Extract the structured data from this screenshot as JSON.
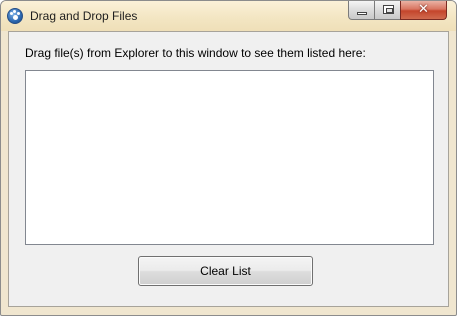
{
  "window": {
    "title": "Drag and Drop Files",
    "icon": "paw-icon"
  },
  "caption_buttons": {
    "minimize": "minimize-icon",
    "maximize": "maximize-icon",
    "close_glyph": "✕"
  },
  "main": {
    "prompt": "Drag file(s) from Explorer to this window to see them listed here:",
    "file_list": [],
    "clear_button_label": "Clear List"
  },
  "colors": {
    "close_button": "#c4452c",
    "titlebar": "#f3e6c3"
  }
}
